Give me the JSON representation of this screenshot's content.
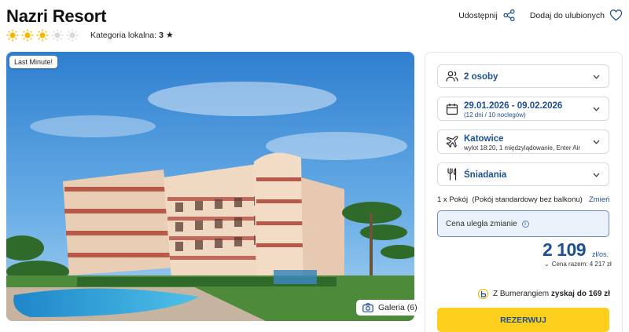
{
  "hotel": {
    "name": "Nazri Resort",
    "rating_suns": 3,
    "rating_max": 5,
    "category_label": "Kategoria lokalna:",
    "category_value": "3"
  },
  "actions": {
    "share_label": "Udostępnij",
    "favorite_label": "Dodaj do ulubionych"
  },
  "photo": {
    "badge": "Last Minute!",
    "gallery_label": "Galeria (6)"
  },
  "booking": {
    "persons": "2 osoby",
    "dates": "29.01.2026 - 09.02.2026",
    "dates_sub": "(12 dni / 10 noclegów)",
    "departure": "Katowice",
    "departure_sub": "wylot 18:20, 1 międzylądowanie, Enter Air",
    "board": "Śniadania",
    "room": "1 x Pokój  (Pokój standardowy bez balkonu)",
    "change_label": "Zmień",
    "notice": "Cena uległa zmianie",
    "price": "2 109",
    "price_unit": "zł/os.",
    "total": "Cena razem: 4 217 zł",
    "boomerang_prefix": "Z Bumerangiem ",
    "boomerang_bold": "zyskaj do 169 zł",
    "reserve_label": "REZERWUJ"
  },
  "colors": {
    "brand_blue": "#1d4f91",
    "cta_yellow": "#fccf1c",
    "sun_yellow": "#f5b800",
    "sun_empty": "#d9d9d9"
  }
}
